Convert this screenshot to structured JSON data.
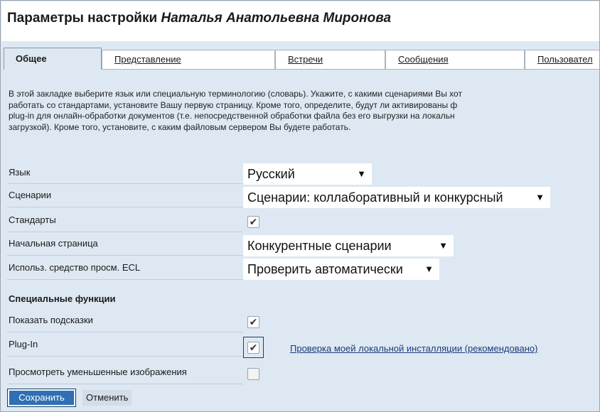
{
  "header": {
    "title_prefix": "Параметры настройки",
    "user_name": "Наталья Анатольевна Миронова"
  },
  "tabs": [
    {
      "label": "Общее",
      "active": true
    },
    {
      "label": "Представление",
      "active": false
    },
    {
      "label": "Встречи",
      "active": false
    },
    {
      "label": "Сообщения",
      "active": false
    },
    {
      "label": "Пользовател",
      "active": false
    }
  ],
  "description": [
    "В этой закладке выберите язык или специальную терминологию (словарь). Укажите, с какими сценариями Вы хот",
    "работать со стандартами, установите Вашу первую страницу. Кроме того, определите, будут ли активированы ф",
    "plug-in для онлайн-обработки документов (т.е. непосредственной обработки файла без его выгрузки на локальн",
    "загрузкой). Кроме того, установите, с каким файловым сервером Вы будете работать."
  ],
  "settings": {
    "language": {
      "label": "Язык",
      "value": "Русский"
    },
    "scenarios": {
      "label": "Сценарии",
      "value": "Сценарии: коллаборативный и конкурсный"
    },
    "standards": {
      "label": "Стандарты",
      "checked": true
    },
    "start_page": {
      "label": "Начальная страница",
      "value": "Конкурентные сценарии"
    },
    "ecl_viewer": {
      "label": "Использ. средство просм. ECL",
      "value": "Проверить автоматически"
    }
  },
  "special": {
    "heading": "Специальные функции",
    "show_hints": {
      "label": "Показать подсказки",
      "checked": true
    },
    "plugin": {
      "label": "Plug-In",
      "checked": true
    },
    "check_link": "Проверка моей локальной инсталляции (рекомендовано)",
    "thumbnails": {
      "label": "Просмотреть уменьшенные изображения",
      "checked": false
    }
  },
  "actions": {
    "save": "Сохранить",
    "cancel": "Отменить"
  },
  "icons": {
    "dropdown": "▼",
    "checkmark": "✔"
  }
}
